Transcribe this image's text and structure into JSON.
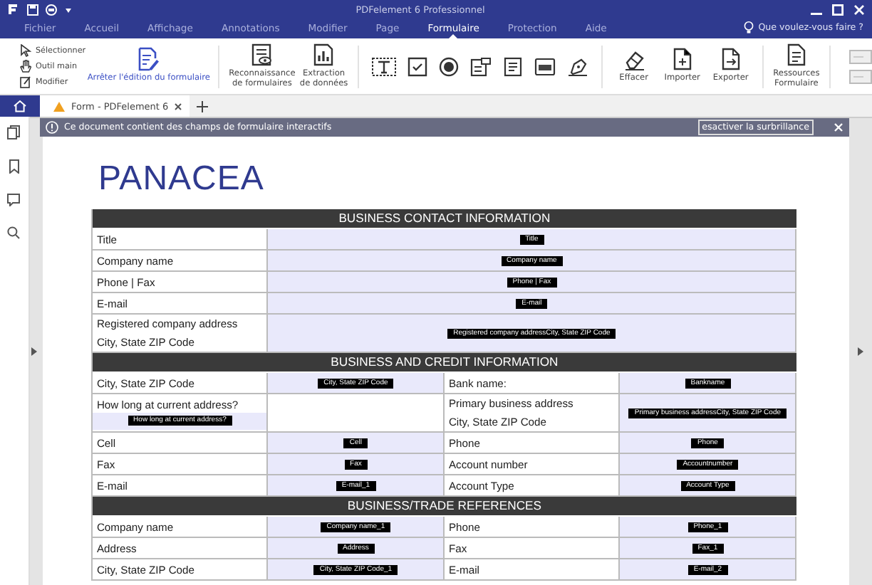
{
  "window": {
    "title": "PDFelement 6 Professionnel"
  },
  "menu": [
    {
      "label": "Fichier",
      "selected": false
    },
    {
      "label": "Accueil",
      "selected": false
    },
    {
      "label": "Affichage",
      "selected": false
    },
    {
      "label": "Annotations",
      "selected": false
    },
    {
      "label": "Modifier",
      "selected": false
    },
    {
      "label": "Page",
      "selected": false
    },
    {
      "label": "Formulaire",
      "selected": true
    },
    {
      "label": "Protection",
      "selected": false
    },
    {
      "label": "Aide",
      "selected": false
    }
  ],
  "help_search": {
    "placeholder": "Que voulez-vous faire ?"
  },
  "ribbon": {
    "small_tools": [
      {
        "label": "Sélectionner",
        "kind": "cursor"
      },
      {
        "label": "Outil main",
        "kind": "hand"
      },
      {
        "label": "Modifier",
        "kind": "edit"
      }
    ],
    "tools": [
      {
        "label": "Arrêter l'édition du formulaire",
        "kind": "stop-edit",
        "active": true
      },
      {
        "label": "Reconnaissance\nde formulaires",
        "kind": "recognize",
        "active": false
      },
      {
        "label": "Extraction\nde données",
        "kind": "extract",
        "active": false
      },
      {
        "kind": "text-field"
      },
      {
        "kind": "checkbox"
      },
      {
        "kind": "radio"
      },
      {
        "kind": "combo"
      },
      {
        "kind": "list"
      },
      {
        "kind": "button"
      },
      {
        "kind": "signature"
      },
      {
        "label": "Effacer",
        "kind": "erase",
        "active": false
      },
      {
        "label": "Importer",
        "kind": "import",
        "active": false
      },
      {
        "label": "Exporter",
        "kind": "export",
        "active": false
      },
      {
        "label": "Ressources\nFormulaire",
        "kind": "resources",
        "active": false
      }
    ]
  },
  "doc_tabs": [
    {
      "label": "Form - PDFelement 6",
      "selected": true
    }
  ],
  "notice": {
    "text": "Ce document contient des champs de formulaire interactifs",
    "button": "esactiver la surbrillance"
  },
  "document": {
    "logo": "PANACEA",
    "sections": [
      {
        "title": "BUSINESS CONTACT INFORMATION",
        "rows": [
          [
            {
              "kind": "label",
              "text": "Title"
            },
            {
              "kind": "field",
              "value": "Title"
            }
          ],
          [
            {
              "kind": "label",
              "text": "Company name"
            },
            {
              "kind": "field",
              "value": "Company name"
            }
          ],
          [
            {
              "kind": "label",
              "text": "Phone | Fax"
            },
            {
              "kind": "field",
              "value": "Phone | Fax"
            }
          ],
          [
            {
              "kind": "label",
              "text": "E-mail"
            },
            {
              "kind": "field",
              "value": "E-mail"
            }
          ],
          [
            {
              "kind": "label",
              "text": "Registered company address\nCity, State ZIP Code"
            },
            {
              "kind": "field",
              "value": "Registered company addressCity, State ZIP Code"
            }
          ]
        ]
      },
      {
        "title": "BUSINESS AND CREDIT INFORMATION",
        "rows": [
          [
            {
              "kind": "label",
              "text": "City, State ZIP Code"
            },
            {
              "kind": "field",
              "value": "City, State ZIP Code"
            },
            {
              "kind": "label",
              "text": "Bank name:"
            },
            {
              "kind": "field",
              "value": "Bankname"
            }
          ],
          [
            {
              "kind": "label_field",
              "text": "How long at current address?",
              "value": "How long at current address?"
            },
            {
              "kind": "blank"
            },
            {
              "kind": "label",
              "text": "Primary business address\nCity, State ZIP Code"
            },
            {
              "kind": "field",
              "value": "Primary business addressCity, State ZIP Code"
            }
          ],
          [
            {
              "kind": "label",
              "text": "Cell"
            },
            {
              "kind": "field",
              "value": "Cell"
            },
            {
              "kind": "label",
              "text": "Phone"
            },
            {
              "kind": "field",
              "value": "Phone"
            }
          ],
          [
            {
              "kind": "label",
              "text": "Fax"
            },
            {
              "kind": "field",
              "value": "Fax"
            },
            {
              "kind": "label",
              "text": "Account number"
            },
            {
              "kind": "field",
              "value": "Accountnumber"
            }
          ],
          [
            {
              "kind": "label",
              "text": "E-mail"
            },
            {
              "kind": "field",
              "value": "E-mail_1"
            },
            {
              "kind": "label",
              "text": "Account Type"
            },
            {
              "kind": "field",
              "value": "Account Type"
            }
          ]
        ]
      },
      {
        "title": "BUSINESS/TRADE REFERENCES",
        "rows": [
          [
            {
              "kind": "label",
              "text": "Company name"
            },
            {
              "kind": "field",
              "value": "Company name_1"
            },
            {
              "kind": "label",
              "text": "Phone"
            },
            {
              "kind": "field",
              "value": "Phone_1"
            }
          ],
          [
            {
              "kind": "label",
              "text": "Address"
            },
            {
              "kind": "field",
              "value": "Address"
            },
            {
              "kind": "label",
              "text": "Fax"
            },
            {
              "kind": "field",
              "value": "Fax_1"
            }
          ],
          [
            {
              "kind": "label",
              "text": "City, State ZIP Code"
            },
            {
              "kind": "field",
              "value": "City, State ZIP Code_1"
            },
            {
              "kind": "label",
              "text": "E-mail"
            },
            {
              "kind": "field",
              "value": "E-mail_2"
            }
          ]
        ]
      }
    ]
  }
}
